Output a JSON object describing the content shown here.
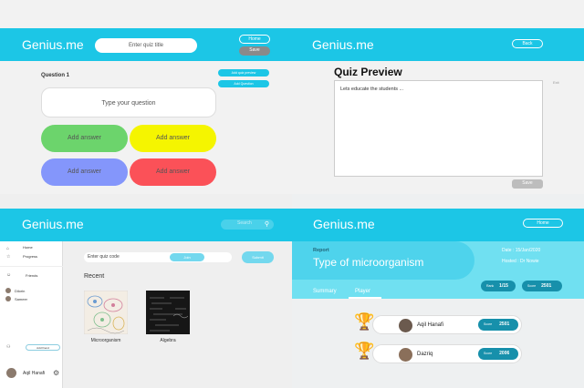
{
  "panel1": {
    "brand": "Genius.me",
    "quiz_title_placeholder": "Enter quiz title",
    "home_label": "Home",
    "save_label": "Save",
    "question_label": "Question 1",
    "add_quiz_preview_label": "Add quiz preview",
    "add_question_label": "Add Question",
    "question_placeholder": "Type your question",
    "answers": [
      "Add answer",
      "Add answer",
      "Add answer",
      "Add answer"
    ],
    "answer_colors": [
      "#6cd46c",
      "#f5f500",
      "#8496fb",
      "#fb5158"
    ]
  },
  "panel2": {
    "brand": "Genius.me",
    "back_label": "Back",
    "title": "Quiz Preview",
    "body_text": "Lets educate the students ...",
    "save_label": "Save",
    "side_text": "Exit"
  },
  "panel3": {
    "brand": "Genius.me",
    "search_placeholder": "Search",
    "sidebar": {
      "home_label": "Home",
      "progress_label": "Progress",
      "friends_label": "Friends",
      "friend1": "Dilorin",
      "friend2": "Sameer",
      "add_friend_label": "Add friend",
      "user_name": "Aqil Hanafi"
    },
    "quiz_code_placeholder": "Enter quiz code",
    "join_label": "Join",
    "submit_label": "Submit",
    "recent_label": "Recent",
    "items": [
      "Microorganism",
      "Algebra"
    ]
  },
  "panel4": {
    "brand": "Genius.me",
    "home_label": "Home",
    "report_label": "Report",
    "report_title": "Type of microorganism",
    "date_label": "Date : 15/Jan/2020",
    "hosted_label": "Hosted : Dr Nowie",
    "rank_label": "Rank",
    "rank_value": "1/15",
    "score_label": "Score",
    "score_value": "2501",
    "tabs": [
      "Summary",
      "Player"
    ],
    "players": [
      {
        "name": "Aqil Hanafi",
        "score_label": "Score",
        "score": "2501"
      },
      {
        "name": "Dazriq",
        "score_label": "Score",
        "score": "2006"
      }
    ]
  }
}
